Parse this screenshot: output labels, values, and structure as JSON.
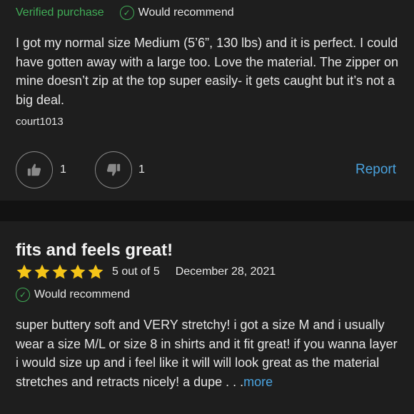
{
  "review1": {
    "verified_label": "Verified purchase",
    "recommend_label": "Would recommend",
    "body": "I got my normal size Medium (5’6”, 130 lbs) and it is perfect. I could have gotten away with a large too. Love the material. The zipper on mine doesn’t zip at the top super easily- it gets caught but it’s not a big deal.",
    "author": "court1013",
    "helpful_count": "1",
    "unhelpful_count": "1",
    "report_label": "Report"
  },
  "review2": {
    "title": "fits and feels great!",
    "stars": 5,
    "rating_text": "5 out of 5",
    "date": "December 28, 2021",
    "recommend_label": "Would recommend",
    "body": "super buttery soft and VERY stretchy! i got a size M and i usually wear a size M/L or size 8 in shirts and it fit great! if you wanna layer i would size up and i feel like it will will look great as the material stretches and retracts nicely! a dupe",
    "ellipsis": " . . .",
    "more_label": "more"
  },
  "colors": {
    "background": "#1e1e1e",
    "separator": "#121212",
    "verified_green": "#41ad57",
    "link_blue": "#4aa3df",
    "star_gold": "#f5c518"
  },
  "icons": [
    "check-circle-icon",
    "thumbs-up-icon",
    "thumbs-down-icon",
    "star-icon"
  ]
}
